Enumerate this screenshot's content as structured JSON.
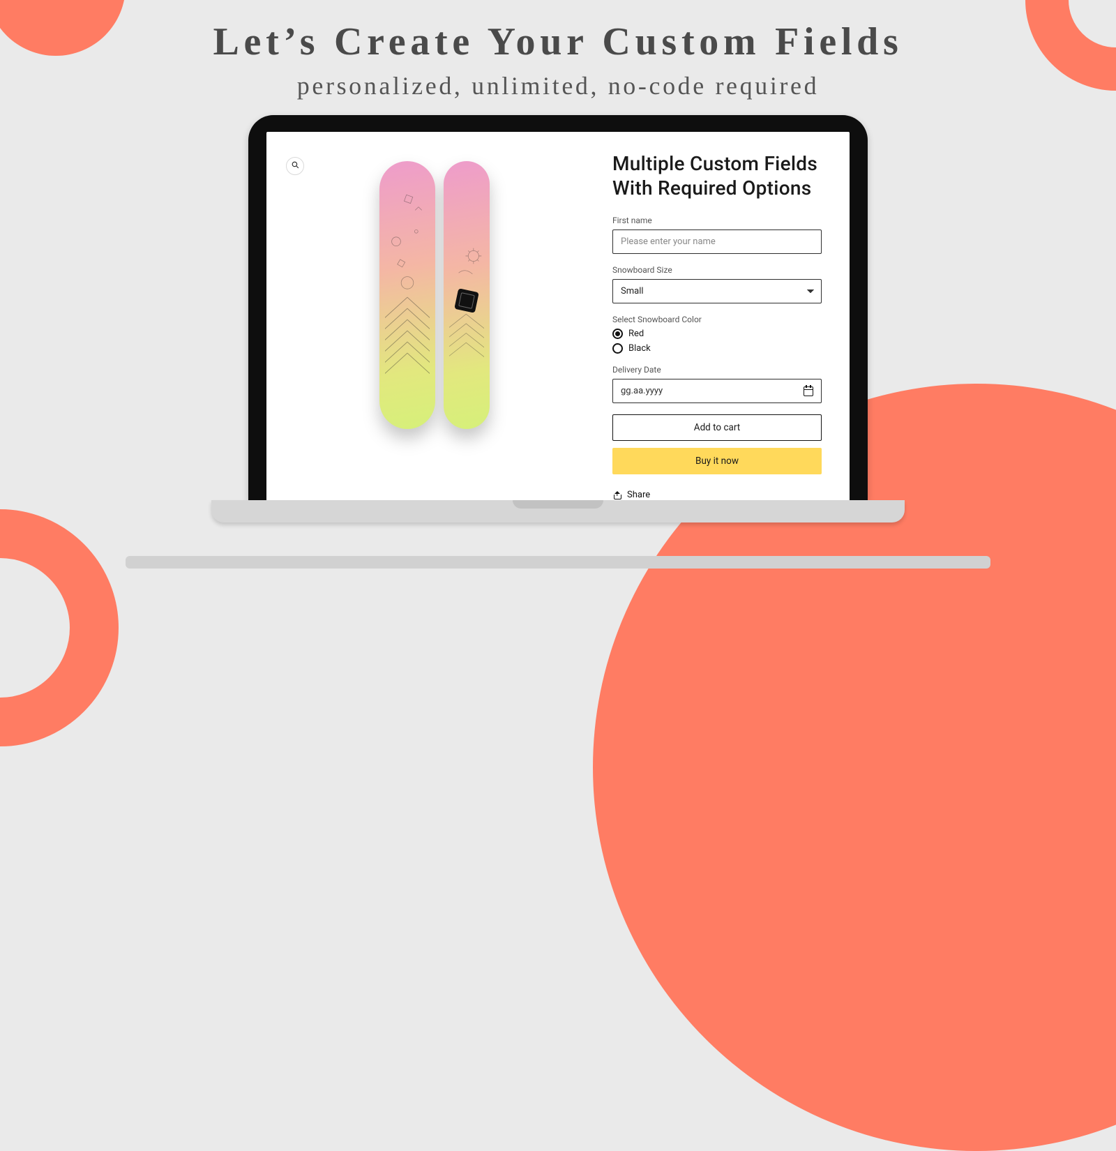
{
  "hero": {
    "title": "Let’s Create Your Custom Fields",
    "subtitle": "personalized, unlimited, no-code required"
  },
  "product": {
    "title": "Multiple Custom Fields With Required Options",
    "zoom_label": "Zoom",
    "zoom_icon": "zoom-in-icon"
  },
  "fields": {
    "first_name": {
      "label": "First name",
      "placeholder": "Please enter your name",
      "value": ""
    },
    "size": {
      "label": "Snowboard Size",
      "selected": "Small",
      "options": [
        "Small"
      ]
    },
    "color": {
      "label": "Select Snowboard Color",
      "options": [
        {
          "label": "Red",
          "checked": true
        },
        {
          "label": "Black",
          "checked": false
        }
      ]
    },
    "delivery": {
      "label": "Delivery Date",
      "placeholder": "gg.aa.yyyy"
    }
  },
  "actions": {
    "add_to_cart": "Add to cart",
    "buy_now": "Buy it now"
  },
  "share": {
    "label": "Share"
  }
}
